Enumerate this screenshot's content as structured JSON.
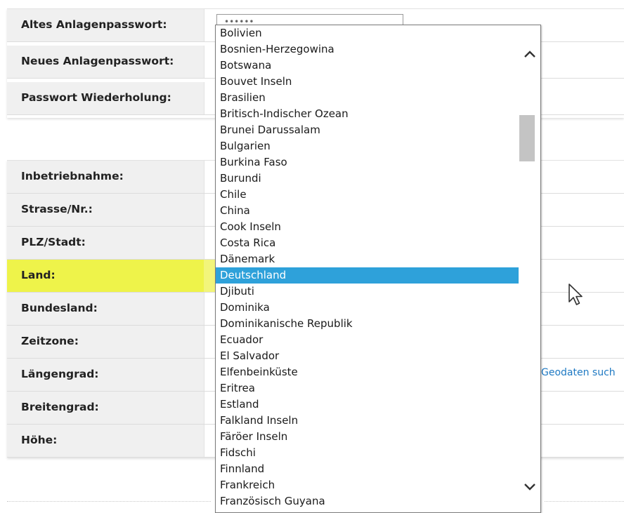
{
  "password_section": {
    "rows": [
      {
        "label": "Altes Anlagenpasswort:"
      },
      {
        "label": "Neues Anlagenpasswort:"
      },
      {
        "label": "Passwort Wiederholung:"
      }
    ],
    "old_password_value": "••••••"
  },
  "location_section": {
    "rows": [
      {
        "label": "Inbetriebnahme:"
      },
      {
        "label": "Strasse/Nr.:"
      },
      {
        "label": "PLZ/Stadt:"
      },
      {
        "label": "Land:"
      },
      {
        "label": "Bundesland:"
      },
      {
        "label": "Zeitzone:"
      },
      {
        "label": "Längengrad:"
      },
      {
        "label": "Breitengrad:"
      },
      {
        "label": "Höhe:"
      }
    ],
    "geo_link": "Geodaten such"
  },
  "country_dropdown": {
    "selected": "Deutschland",
    "options": [
      "Bolivien",
      "Bosnien-Herzegowina",
      "Botswana",
      "Bouvet Inseln",
      "Brasilien",
      "Britisch-Indischer Ozean",
      "Brunei Darussalam",
      "Bulgarien",
      "Burkina Faso",
      "Burundi",
      "Chile",
      "China",
      "Cook Inseln",
      "Costa Rica",
      "Dänemark",
      "Deutschland",
      "Djibuti",
      "Dominika",
      "Dominikanische Republik",
      "Ecuador",
      "El Salvador",
      "Elfenbeinküste",
      "Eritrea",
      "Estland",
      "Falkland Inseln",
      "Färöer Inseln",
      "Fidschi",
      "Finnland",
      "Frankreich",
      "Französisch Guyana"
    ],
    "scroll_up_icon": "chevron-up-icon",
    "scroll_down_icon": "chevron-down-icon"
  },
  "colors": {
    "highlight": "#eef34a",
    "selected_option": "#2ea1da",
    "link": "#1e79c3",
    "label_bg": "#f0f0f0"
  }
}
